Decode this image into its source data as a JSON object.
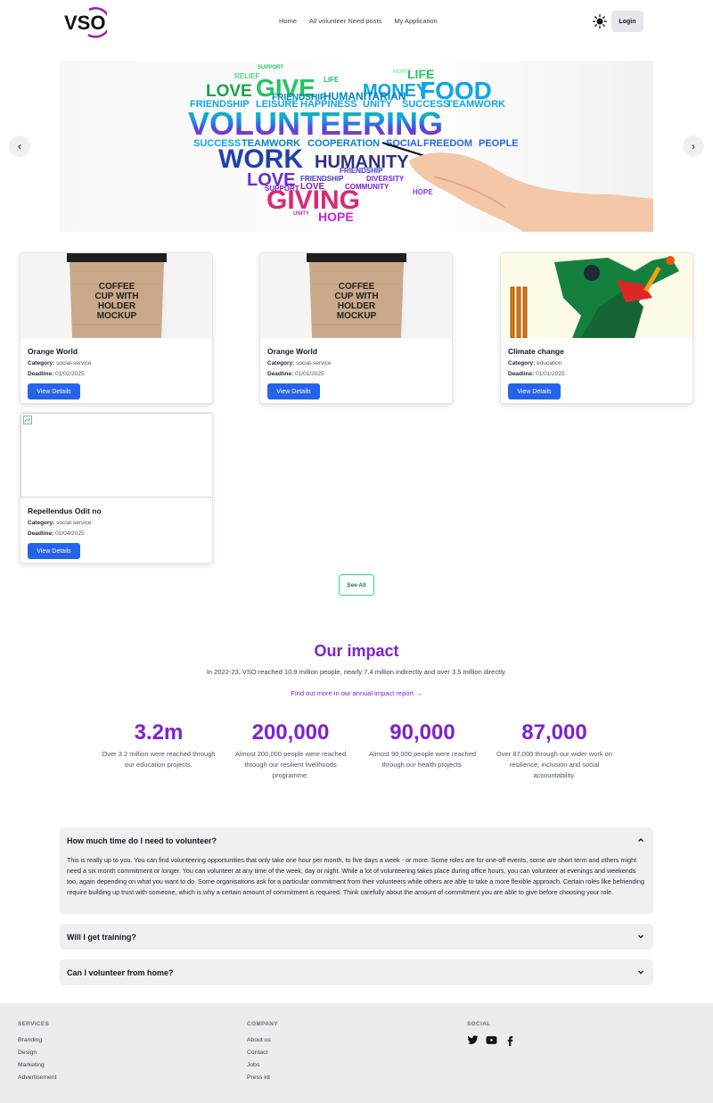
{
  "nav": {
    "logo_text": "VSO",
    "links": [
      "Home",
      "All volunteer Need posts",
      "My Application"
    ],
    "login_label": "Login"
  },
  "hero": {
    "prev_label": "‹",
    "next_label": "›",
    "word_cloud": {
      "title_word": "VOLUNTEERING",
      "words": [
        "GIVE",
        "MONEY",
        "FOOD",
        "LOVE",
        "LIFE",
        "HOPE",
        "RELIEF",
        "SUPPORT",
        "FRIENDSHIP",
        "HUMANITARIAN",
        "LEISURE",
        "HAPPINESS",
        "UNITY",
        "SUCCESS",
        "TEAMWORK",
        "COOPERATION",
        "SOCIAL",
        "FREEDOM",
        "PEOPLE",
        "WORK",
        "HUMANITY",
        "DIVERSITY",
        "COMMUNITY",
        "GIVING"
      ]
    }
  },
  "posts": [
    {
      "title": "Orange World",
      "category_label": "Category:",
      "category": "social-service",
      "deadline_label": "Deadline:",
      "deadline": "01/02/2025",
      "button": "View Details",
      "image": "coffee-cup-mockup"
    },
    {
      "title": "Orange World",
      "category_label": "Category:",
      "category": "social-service",
      "deadline_label": "Deadline:",
      "deadline": "01/01/2025",
      "button": "View Details",
      "image": "coffee-cup-mockup"
    },
    {
      "title": "Climate change",
      "category_label": "Category:",
      "category": "education",
      "deadline_label": "Deadline:",
      "deadline": "01/01/2025",
      "button": "View Details",
      "image": "cricket-player"
    },
    {
      "title": "Repellendus Odit no",
      "category_label": "Category:",
      "category": "social-service",
      "deadline_label": "Deadline:",
      "deadline": "01/04/2025",
      "button": "View Details",
      "image": "broken-image"
    }
  ],
  "mockup": {
    "line1": "COFFEE",
    "line2": "CUP WITH",
    "line3": "HOLDER",
    "line4": "MOCKUP"
  },
  "see_all": "See All",
  "impact": {
    "title": "Our impact",
    "subtitle": "In 2022-23, VSO reached 10.9 million people, nearly 7.4 million indirectly and over 3.5 million directly.",
    "link": "Find out more in our annual impact report →",
    "stats": [
      {
        "value": "3.2m",
        "desc": "Over 3.2 million were reached through our education projects."
      },
      {
        "value": "200,000",
        "desc": "Almost 200,000 people were reached through our resilient livelihoods programme."
      },
      {
        "value": "90,000",
        "desc": "Almost 90,000 people were reached through our health projects."
      },
      {
        "value": "87,000",
        "desc": "Over 87,000 through our wider work on resilience, inclusion and social accountability."
      }
    ]
  },
  "faq": [
    {
      "question": "How much time do I need to volunteer?",
      "open": true,
      "answer": "This is really up to you. You can find volunteering opportunities that only take one hour per month, to five days a week - or more. Some roles are for one-off events, some are short term and others might need a six month commitment or longer. You can volunteer at any time of the week, day or night. While a lot of volunteering takes place during office hours, you can volunteer at evenings and weekends too, again depending on what you want to do. Some organisations ask for a particular commitment from their volunteers while others are able to take a more flexible approach. Certain roles like befriending require building up trust with someone, which is why a certain amount of commitment is required. Think carefully about the amount of commitment you are able to give before choosing your role."
    },
    {
      "question": "Will I get training?",
      "open": false
    },
    {
      "question": "Can I volunteer from home?",
      "open": false
    }
  ],
  "footer": {
    "services": {
      "heading": "SERVICES",
      "links": [
        "Branding",
        "Design",
        "Marketing",
        "Advertisement"
      ]
    },
    "company": {
      "heading": "COMPANY",
      "links": [
        "About us",
        "Contact",
        "Jobs",
        "Press kit"
      ]
    },
    "social": {
      "heading": "SOCIAL",
      "icons": [
        "twitter-icon",
        "youtube-icon",
        "facebook-icon"
      ]
    }
  },
  "colors": {
    "accent_purple": "#7e22ce",
    "button_blue": "#2563eb",
    "see_all_green": "#34d399"
  }
}
